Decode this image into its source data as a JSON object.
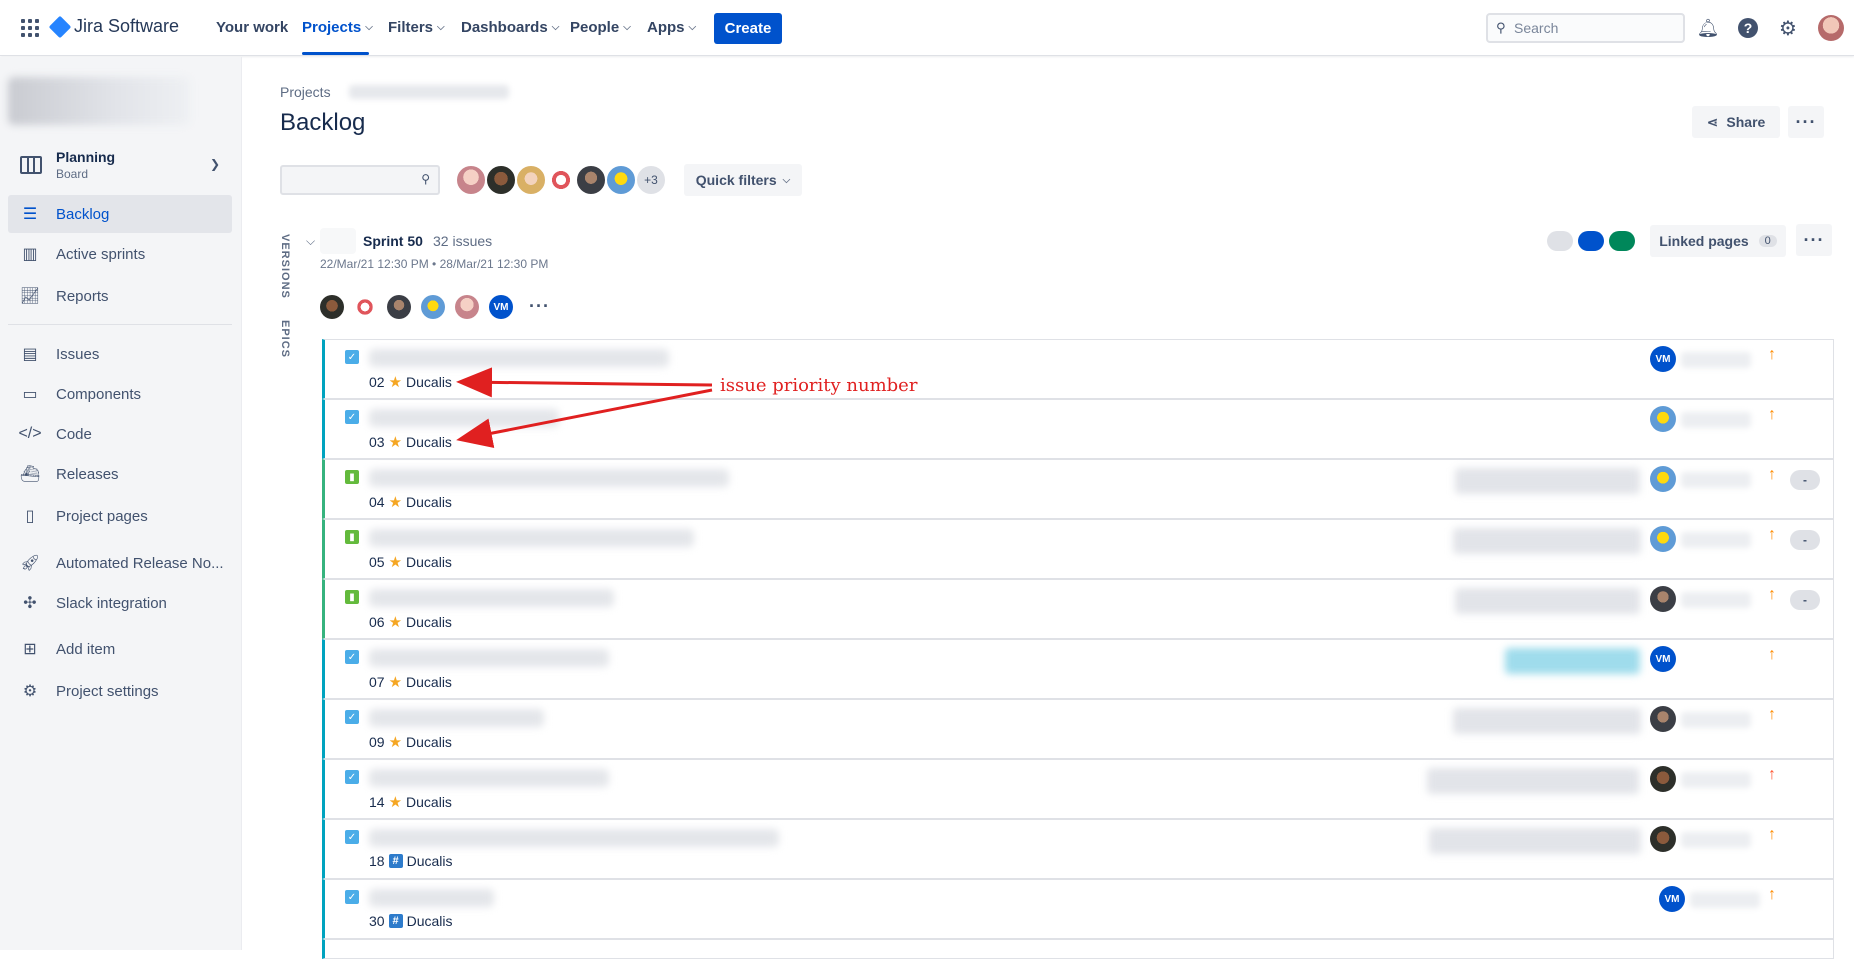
{
  "topnav": {
    "logo": "Jira Software",
    "items": [
      {
        "label": "Your work"
      },
      {
        "label": "Projects"
      },
      {
        "label": "Filters"
      },
      {
        "label": "Dashboards"
      },
      {
        "label": "People"
      },
      {
        "label": "Apps"
      }
    ],
    "create_label": "Create",
    "search_placeholder": "Search"
  },
  "sidebar": {
    "planning_title": "Planning",
    "planning_sub": "Board",
    "items": [
      {
        "label": "Backlog",
        "icon": "backlog-icon"
      },
      {
        "label": "Active sprints",
        "icon": "board-icon"
      },
      {
        "label": "Reports",
        "icon": "chart-icon"
      },
      {
        "label": "Issues",
        "icon": "issues-icon"
      },
      {
        "label": "Components",
        "icon": "components-icon"
      },
      {
        "label": "Code",
        "icon": "code-icon"
      },
      {
        "label": "Releases",
        "icon": "ship-icon"
      },
      {
        "label": "Project pages",
        "icon": "page-icon"
      },
      {
        "label": "Automated Release No...",
        "icon": "rocket-icon"
      },
      {
        "label": "Slack integration",
        "icon": "slack-icon"
      },
      {
        "label": "Add item",
        "icon": "add-item-icon"
      },
      {
        "label": "Project settings",
        "icon": "gear-icon"
      }
    ]
  },
  "main": {
    "breadcrumb": "Projects",
    "title": "Backlog",
    "share_label": "Share",
    "plus_count": "+3",
    "quick_filters": "Quick filters",
    "vtabs": {
      "versions": "VERSIONS",
      "epics": "EPICS"
    },
    "sprint": {
      "name": "Sprint 50",
      "count": "32 issues",
      "dates": "22/Mar/21 12:30 PM • 28/Mar/21 12:30 PM",
      "linked_pages": "Linked pages",
      "linked_count": "0",
      "vm_initials": "VM",
      "status_colors": [
        "#dfe1e6",
        "#0052cc",
        "#00875a"
      ]
    },
    "issues": [
      {
        "type": "task",
        "num": "02",
        "mark": "star",
        "label": "Ducalis",
        "priority": "medium",
        "assignee": "vm",
        "vm": "VM"
      },
      {
        "type": "task",
        "num": "03",
        "mark": "star",
        "label": "Ducalis",
        "priority": "medium",
        "assignee": "homer"
      },
      {
        "type": "story",
        "num": "04",
        "mark": "star",
        "label": "Ducalis",
        "priority": "medium",
        "assignee": "homer",
        "points": "-"
      },
      {
        "type": "story",
        "num": "05",
        "mark": "star",
        "label": "Ducalis",
        "priority": "medium",
        "assignee": "homer",
        "points": "-"
      },
      {
        "type": "story",
        "num": "06",
        "mark": "star",
        "label": "Ducalis",
        "priority": "medium",
        "assignee": "beard",
        "points": "-"
      },
      {
        "type": "task",
        "num": "07",
        "mark": "star",
        "label": "Ducalis",
        "priority": "medium",
        "assignee": "vm",
        "vm": "VM"
      },
      {
        "type": "task",
        "num": "09",
        "mark": "star",
        "label": "Ducalis",
        "priority": "medium",
        "assignee": "beard"
      },
      {
        "type": "task",
        "num": "14",
        "mark": "star",
        "label": "Ducalis",
        "priority": "high",
        "assignee": "dark"
      },
      {
        "type": "task",
        "num": "18",
        "mark": "hash",
        "label": "Ducalis",
        "priority": "medium",
        "assignee": "dark"
      },
      {
        "type": "task",
        "num": "30",
        "mark": "hash",
        "label": "Ducalis",
        "priority": "medium",
        "assignee": "vm",
        "vm": "VM"
      }
    ]
  },
  "annotation": {
    "text": "issue priority number",
    "color": "#e02020"
  }
}
